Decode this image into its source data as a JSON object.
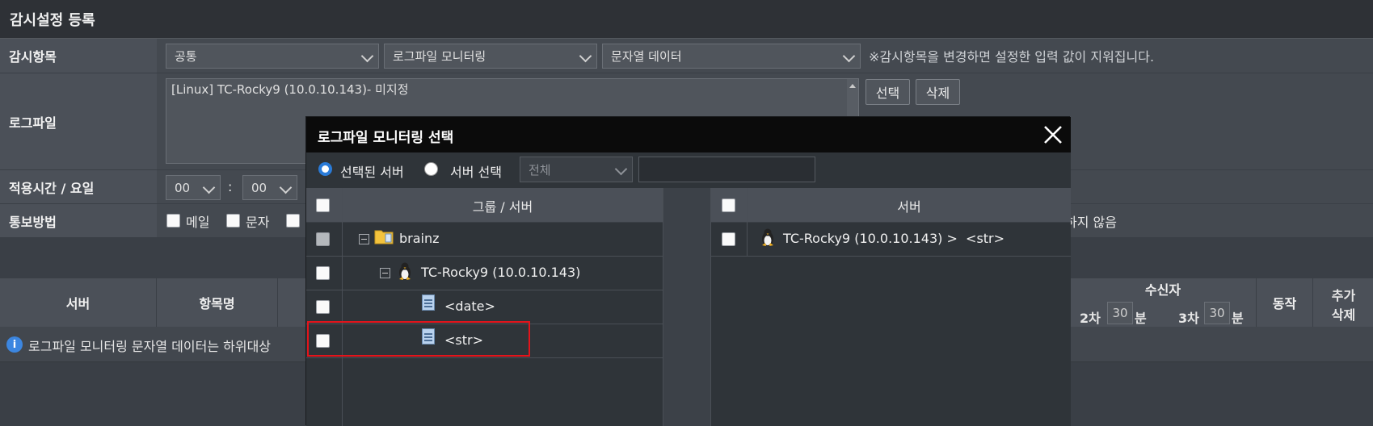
{
  "window": {
    "title": "감시설정 등록"
  },
  "form": {
    "item_label": "감시항목",
    "item_select1": "공통",
    "item_select2": "로그파일 모니터링",
    "item_select3": "문자열 데이터",
    "item_note": "※감시항목을 변경하면 설정한 입력 값이 지워집니다.",
    "logfile_label": "로그파일",
    "logfile_value": "[Linux] TC-Rocky9 (10.0.10.143)- 미지정",
    "select_button": "선택",
    "delete_button": "삭제",
    "time_label": "적용시간 / 요일",
    "hour_value": "00",
    "colon": ":",
    "minute_value": "00",
    "notify_label": "통보방법",
    "notify_mail": "메일",
    "notify_sms": "문자",
    "notify_none_partial": "하지 않음"
  },
  "grid": {
    "col_server": "서버",
    "col_item": "항목명",
    "col_receiver": "수신자",
    "second_label": "2차",
    "second_value": "30",
    "second_unit": "분",
    "third_label": "3차",
    "third_value": "30",
    "third_unit": "분",
    "col_action": "동작",
    "col_add": "추가",
    "col_delete": "삭제",
    "info_text": "로그파일 모니터링 문자열 데이터는 하위대상"
  },
  "modal": {
    "title": "로그파일 모니터링 선택",
    "radio_selected": "선택된 서버",
    "radio_choose": "서버 선택",
    "filter_value": "전체",
    "left_header": "그룹 / 서버",
    "tree": [
      {
        "label": "brainz",
        "icon": "folder-icon"
      },
      {
        "label": "TC-Rocky9 (10.0.10.143)",
        "icon": "linux-icon"
      },
      {
        "label": "<date>",
        "icon": "file-icon"
      },
      {
        "label": "<str>",
        "icon": "file-icon"
      }
    ],
    "right_header": "서버",
    "selected_rows": [
      {
        "label": "TC-Rocky9 (10.0.10.143) >  <str>",
        "icon": "linux-icon"
      }
    ]
  },
  "colors": {
    "highlight": "#e3141b",
    "radio": "#2a7bd8"
  }
}
